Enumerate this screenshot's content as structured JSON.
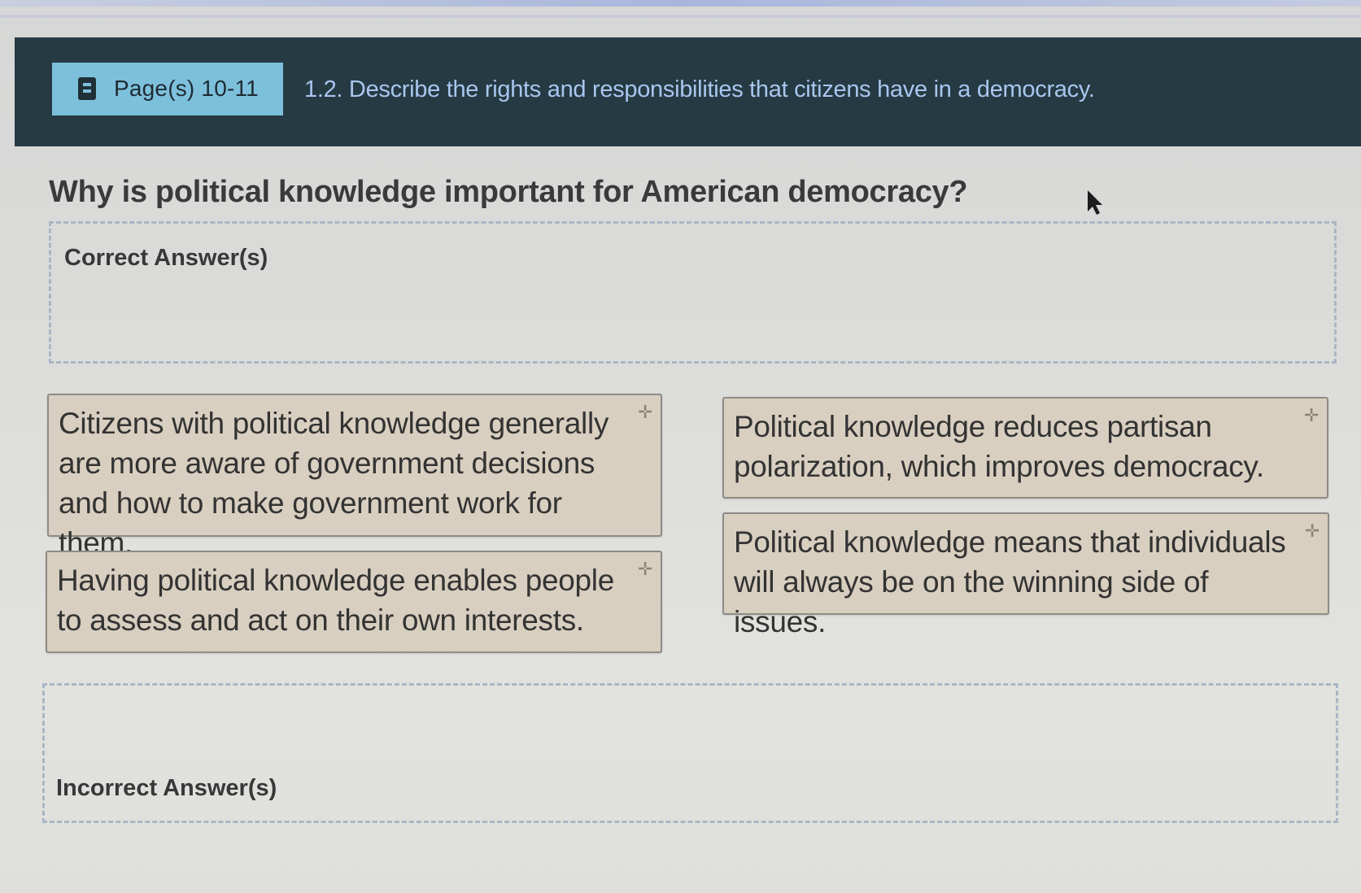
{
  "header": {
    "page_ref": "Page(s) 10-11",
    "objective": "1.2. Describe the rights and responsibilities that citizens have in a democracy."
  },
  "question": "Why is political knowledge important for American democracy?",
  "dropzones": {
    "correct_label": "Correct Answer(s)",
    "incorrect_label": "Incorrect Answer(s)"
  },
  "cards": [
    "Citizens with political knowledge generally are more aware of government decisions and how to make government work for them.",
    "Having political knowledge enables people to assess and act on their own interests.",
    "Political knowledge reduces partisan polarization, which improves democracy.",
    "Political knowledge means that individuals will always be on the winning side of issues."
  ],
  "colors": {
    "header_bg": "#263a44",
    "page_ref_bg": "#7dc0dc",
    "objective_text": "#a9c6ee",
    "card_bg": "#d9cfc0"
  },
  "icons": {
    "page_ref": "book-icon",
    "card_handle": "move-icon",
    "pointer": "cursor-icon"
  }
}
